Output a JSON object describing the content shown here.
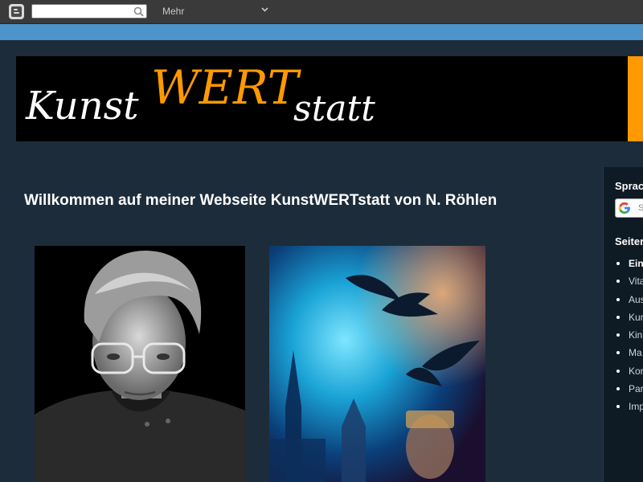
{
  "navbar": {
    "search_value": "",
    "more_label": "Mehr",
    "logo_icon": "blogger-icon",
    "search_icon": "search-icon",
    "chevron_icon": "chevron-down-icon"
  },
  "header": {
    "logo_part1": "Kunst",
    "logo_part2": "WERT",
    "logo_part3": "statt",
    "accent_color": "#ff9900"
  },
  "main": {
    "welcome": "Willkommen auf meiner Webseite KunstWERTstatt von N. Röhlen",
    "images": [
      {
        "name": "portrait-photo",
        "kind": "black-and-white portrait"
      },
      {
        "name": "artwork-image",
        "kind": "blue digital artwork"
      }
    ]
  },
  "sidebar": {
    "language_heading": "Sprac",
    "translate_placeholder": "S",
    "pages_heading": "Seiter",
    "pages": [
      {
        "label": "Ein",
        "active": true
      },
      {
        "label": "Vita",
        "active": false
      },
      {
        "label": "Aus",
        "active": false
      },
      {
        "label": "Kun",
        "active": false
      },
      {
        "label": "Kin",
        "active": false
      },
      {
        "label": "Ma",
        "active": false
      },
      {
        "label": "Kor",
        "active": false
      },
      {
        "label": "Par",
        "active": false
      },
      {
        "label": "Imp",
        "active": false
      }
    ]
  }
}
